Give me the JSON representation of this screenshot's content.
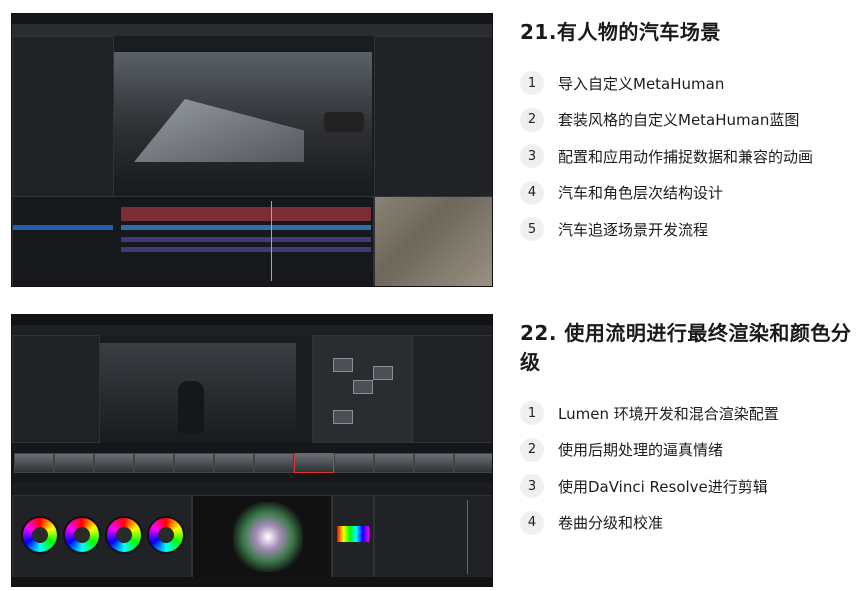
{
  "sections": [
    {
      "title": "21.有人物的汽车场景",
      "items": [
        {
          "num": "1",
          "text": "导入自定义MetaHuman"
        },
        {
          "num": "2",
          "text": "套装风格的自定义MetaHuman蓝图"
        },
        {
          "num": "3",
          "text": "配置和应用动作捕捉数据和兼容的动画"
        },
        {
          "num": "4",
          "text": "汽车和角色层次结构设计"
        },
        {
          "num": "5",
          "text": "汽车追逐场景开发流程"
        }
      ]
    },
    {
      "title": "22. 使用流明进行最终渲染和颜色分级",
      "items": [
        {
          "num": "1",
          "text": "Lumen 环境开发和混合渲染配置"
        },
        {
          "num": "2",
          "text": "使用后期处理的逼真情绪"
        },
        {
          "num": "3",
          "text": "使用DaVinci Resolve进行剪辑"
        },
        {
          "num": "4",
          "text": "卷曲分级和校准"
        }
      ]
    }
  ]
}
